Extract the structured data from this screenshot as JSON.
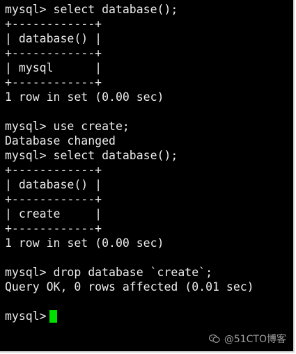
{
  "terminal": {
    "lines": [
      "mysql> select database();",
      "+------------+",
      "| database() |",
      "+------------+",
      "| mysql      |",
      "+------------+",
      "1 row in set (0.00 sec)",
      "",
      "mysql> use create;",
      "Database changed",
      "mysql> select database();",
      "+------------+",
      "| database() |",
      "+------------+",
      "| create     |",
      "+------------+",
      "1 row in set (0.00 sec)",
      "",
      "mysql> drop database `create`;",
      "Query OK, 0 rows affected (0.01 sec)",
      ""
    ],
    "prompt": "mysql>",
    "cursor_color": "#00e000"
  },
  "watermark": {
    "text": "@51CTO博客",
    "icon": "wechat-icon"
  }
}
